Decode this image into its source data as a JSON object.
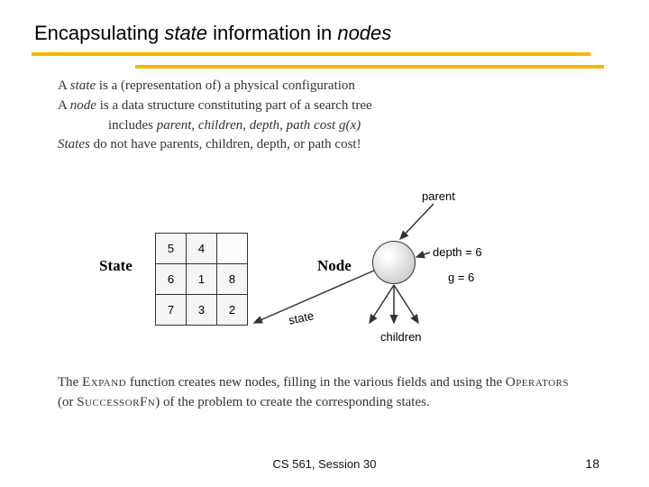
{
  "title": {
    "pre": "Encapsulating ",
    "ital1": "state",
    "mid": " information in ",
    "ital2": "nodes"
  },
  "defs": {
    "l1a": "A ",
    "l1b": "state",
    "l1c": " is a (representation of) a physical configuration",
    "l2a": "A ",
    "l2b": "node",
    "l2c": " is a data structure constituting part of a search tree",
    "l3a": "includes ",
    "l3b": "parent",
    "l3c": ", ",
    "l3d": "children",
    "l3e": ", ",
    "l3f": "depth",
    "l3g": ", ",
    "l3h": "path cost",
    "l3i": " ",
    "l3j": "g(x)",
    "l4a": "States",
    "l4b": " do not have parents, children, depth, or path cost!"
  },
  "state_label": "State",
  "node_label": "Node",
  "grid": [
    [
      "5",
      "4",
      ""
    ],
    [
      "6",
      "1",
      "8"
    ],
    [
      "7",
      "3",
      "2"
    ]
  ],
  "annot": {
    "parent": "parent",
    "depth": "depth = 6",
    "g": "g = 6",
    "children": "children",
    "state": "state"
  },
  "expand": {
    "a": "The ",
    "b": "Expand",
    "c": " function creates new nodes, filling in the various fields and using the ",
    "d": "Operators",
    "e": " (or ",
    "f": "SuccessorFn",
    "g": ") of the problem to create the corresponding states."
  },
  "footer": "CS 561,  Session 30",
  "page": "18"
}
